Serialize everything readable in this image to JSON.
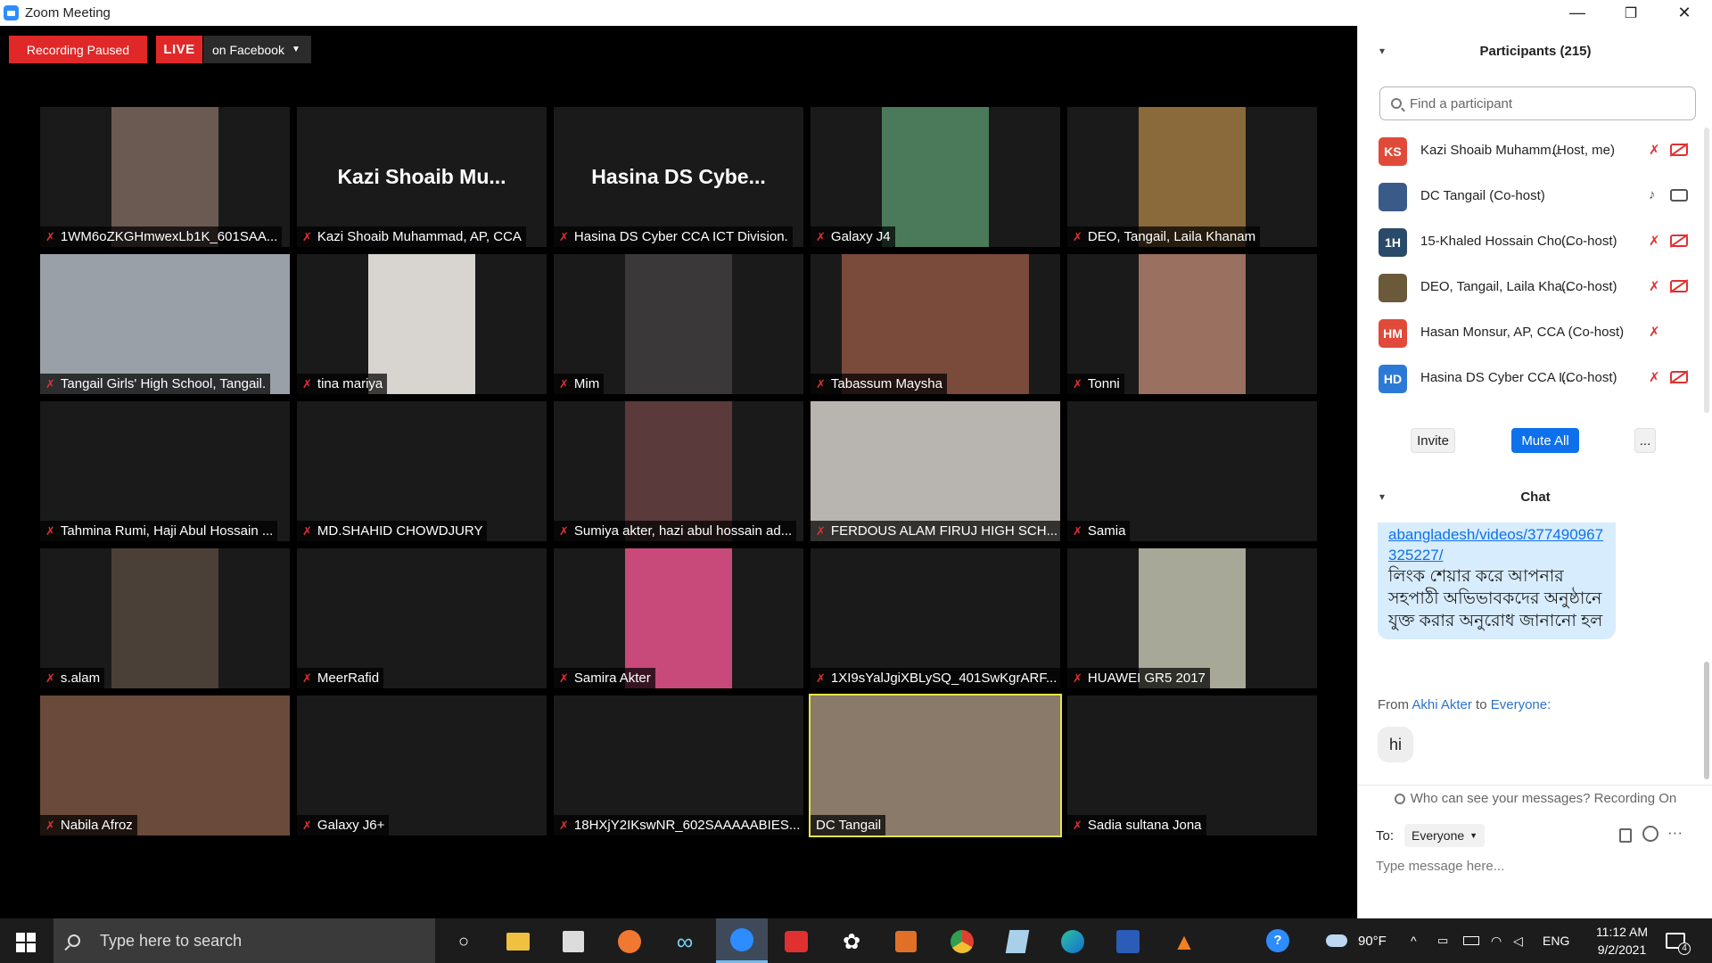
{
  "window": {
    "title": "Zoom Meeting"
  },
  "controls": {
    "minimize": "—",
    "restore": "❐",
    "close": "✕"
  },
  "meeting": {
    "recording_status": "Recording Paused",
    "live_label": "LIVE",
    "live_destination": "on Facebook",
    "tiles": [
      {
        "name": "1WM6oZKGHmwexLb1K_601SAA...",
        "video": "center",
        "color": "#6b5a52",
        "muted": true
      },
      {
        "name": "Kazi Shoaib Muhammad, AP, CCA",
        "display": "Kazi Shoaib Mu...",
        "muted": true
      },
      {
        "name": "Hasina DS Cyber CCA ICT Division.",
        "display": "Hasina DS Cybe...",
        "muted": true
      },
      {
        "name": "Galaxy J4",
        "video": "center",
        "color": "#4a7a5a",
        "muted": true
      },
      {
        "name": "DEO, Tangail, Laila Khanam",
        "video": "center",
        "color": "#8a6a3a",
        "muted": true
      },
      {
        "name": "Tangail Girls' High School, Tangail.",
        "video": "full",
        "color": "#9aa0a8",
        "muted": true
      },
      {
        "name": "tina mariya",
        "video": "center",
        "color": "#d8d4d0",
        "muted": true
      },
      {
        "name": "Mim",
        "video": "center",
        "color": "#3a3838",
        "muted": true
      },
      {
        "name": "Tabassum Maysha",
        "video": "center-wide",
        "color": "#7a4a3a",
        "muted": true
      },
      {
        "name": "Tonni",
        "video": "center",
        "color": "#9a7060",
        "muted": true
      },
      {
        "name": "Tahmina  Rumi, Haji Abul Hossain ...",
        "muted": true
      },
      {
        "name": "MD.SHAHID CHOWDJURY",
        "muted": true
      },
      {
        "name": "Sumiya akter, hazi abul hossain ad...",
        "video": "center",
        "color": "#5a3a3a",
        "muted": true
      },
      {
        "name": "FERDOUS ALAM FIRUJ HIGH SCH...",
        "video": "full",
        "color": "#b8b4b0",
        "muted": true
      },
      {
        "name": "Samia",
        "muted": true
      },
      {
        "name": "s.alam",
        "video": "center",
        "color": "#4a4038",
        "muted": true
      },
      {
        "name": "MeerRafid",
        "muted": true
      },
      {
        "name": "Samira Akter",
        "video": "center",
        "color": "#c84a7a",
        "muted": true
      },
      {
        "name": "1XI9sYalJgiXBLySQ_401SwKgrARF...",
        "muted": true
      },
      {
        "name": "HUAWEI GR5 2017",
        "video": "center",
        "color": "#a8a898",
        "muted": true
      },
      {
        "name": "Nabila Afroz",
        "video": "full",
        "color": "#6a4a3a",
        "muted": true
      },
      {
        "name": "Galaxy J6+",
        "muted": true
      },
      {
        "name": "18HXjY2IKswNR_602SAAAAABIES...",
        "muted": true
      },
      {
        "name": "DC Tangail",
        "video": "full",
        "color": "#8a7a6a",
        "muted": false,
        "active": true
      },
      {
        "name": "Sadia sultana Jona",
        "muted": true
      }
    ]
  },
  "participants": {
    "header": "Participants (215)",
    "search_placeholder": "Find a participant",
    "list": [
      {
        "initials": "KS",
        "color": "#e04a3a",
        "name": "Kazi Shoaib Muhamm...",
        "role": "(Host, me)",
        "mic": "off",
        "cam": "off"
      },
      {
        "initials": "",
        "color": "#3a5a8a",
        "name": "DC Tangail (Co-host)",
        "role": "",
        "mic": "on",
        "cam": "on"
      },
      {
        "initials": "1H",
        "color": "#2a4a6a",
        "name": "15-Khaled Hossain Cho...",
        "role": "(Co-host)",
        "mic": "off",
        "cam": "off"
      },
      {
        "initials": "",
        "color": "#6a5a3a",
        "name": "DEO, Tangail, Laila Kha...",
        "role": "(Co-host)",
        "mic": "off",
        "cam": "off"
      },
      {
        "initials": "HM",
        "color": "#e04a3a",
        "name": "Hasan Monsur, AP, CCA (Co-host)",
        "role": "",
        "mic": "off",
        "cam": "none"
      },
      {
        "initials": "HD",
        "color": "#2d7ad6",
        "name": "Hasina DS Cyber CCA I...",
        "role": "(Co-host)",
        "mic": "off",
        "cam": "off"
      }
    ],
    "invite": "Invite",
    "mute_all": "Mute All",
    "more": "..."
  },
  "chat": {
    "header": "Chat",
    "link": "abangladesh/videos/377490967325227/",
    "message": "লিংক শেয়ার করে আপনার সহপাঠী অভিভাবকদের অনুষ্ঠানে যুক্ত করার অনুরোধ জানানো হল",
    "from_label": "From",
    "from_name": "Akhi Akter",
    "to_label": "to",
    "to_name": "Everyone:",
    "reply": "hi",
    "who_can_see": "Who can see your messages? Recording On",
    "to": "To:",
    "to_value": "Everyone",
    "input_placeholder": "Type message here...",
    "file_icon": "file-icon",
    "emoji_icon": "emoji-icon",
    "more_icon": "···"
  },
  "taskbar": {
    "search_placeholder": "Type here to search",
    "weather": "90°F",
    "lang": "ENG",
    "time": "11:12 AM",
    "date": "9/2/2021",
    "notifications": "4"
  }
}
